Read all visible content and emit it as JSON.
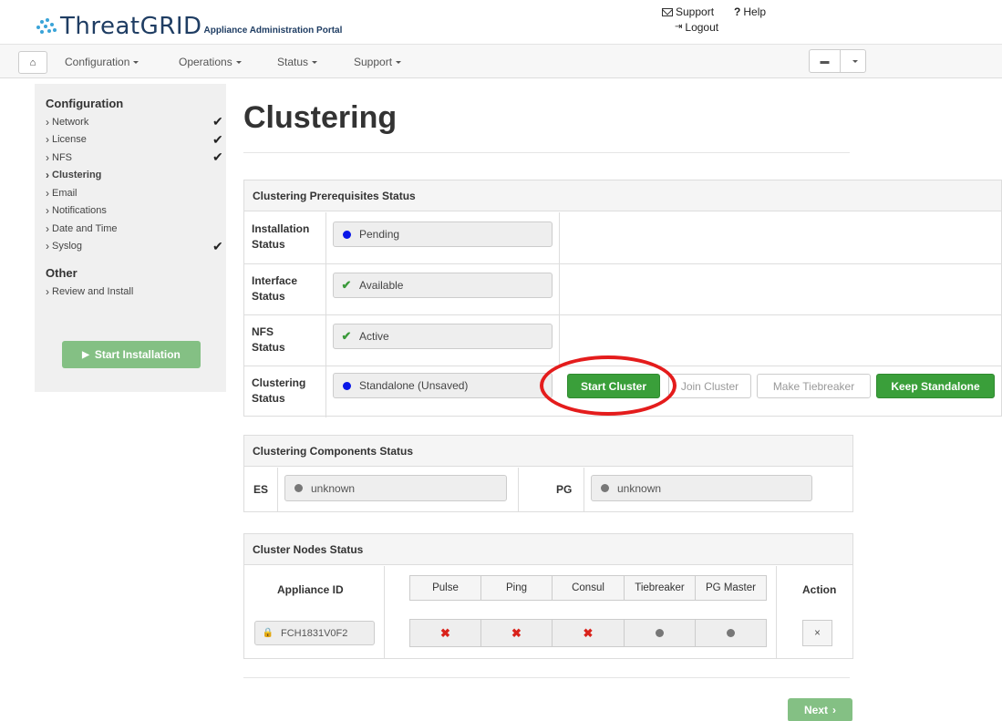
{
  "brand": {
    "name": "ThreatGRID",
    "sub": "Appliance Administration Portal"
  },
  "top_links": {
    "support": "Support",
    "help": "Help",
    "logout": "Logout"
  },
  "nav": {
    "items": [
      "Configuration",
      "Operations",
      "Status",
      "Support"
    ]
  },
  "sidebar": {
    "configuration_heading": "Configuration",
    "items": [
      {
        "label": "Network",
        "checked": true
      },
      {
        "label": "License",
        "checked": true
      },
      {
        "label": "NFS",
        "checked": true
      },
      {
        "label": "Clustering",
        "checked": false,
        "active": true
      },
      {
        "label": "Email",
        "checked": false
      },
      {
        "label": "Notifications",
        "checked": false
      },
      {
        "label": "Date and Time",
        "checked": false
      },
      {
        "label": "Syslog",
        "checked": true
      }
    ],
    "other_heading": "Other",
    "other_items": [
      {
        "label": "Review and Install"
      }
    ],
    "start_installation": "Start Installation"
  },
  "page_title": "Clustering",
  "prerequisites": {
    "title": "Clustering Prerequisites Status",
    "rows": [
      {
        "label_line1": "Installation",
        "label_line2": "Status",
        "value": "Pending",
        "icon": "blue-dot-icon"
      },
      {
        "label_line1": "Interface",
        "label_line2": "Status",
        "value": "Available",
        "icon": "check-icon"
      },
      {
        "label_line1": "NFS",
        "label_line2": "Status",
        "value": "Active",
        "icon": "check-icon"
      },
      {
        "label_line1": "Clustering",
        "label_line2": "Status",
        "value": "Standalone (Unsaved)",
        "icon": "blue-dot-icon"
      }
    ],
    "buttons": {
      "start_cluster": "Start Cluster",
      "join_cluster": "Join Cluster",
      "make_tiebreaker": "Make Tiebreaker",
      "keep_standalone": "Keep Standalone"
    }
  },
  "components": {
    "title": "Clustering Components Status",
    "es_label": "ES",
    "es_value": "unknown",
    "pg_label": "PG",
    "pg_value": "unknown"
  },
  "nodes": {
    "title": "Cluster Nodes Status",
    "appliance_id_header": "Appliance ID",
    "columns": [
      "Pulse",
      "Ping",
      "Consul",
      "Tiebreaker",
      "PG Master"
    ],
    "action_header": "Action",
    "row": {
      "appliance_id": "FCH1831V0F2",
      "pulse": "x",
      "ping": "x",
      "consul": "x",
      "tiebreaker": "dot",
      "pg_master": "dot",
      "action": "×"
    }
  },
  "next": "Next"
}
